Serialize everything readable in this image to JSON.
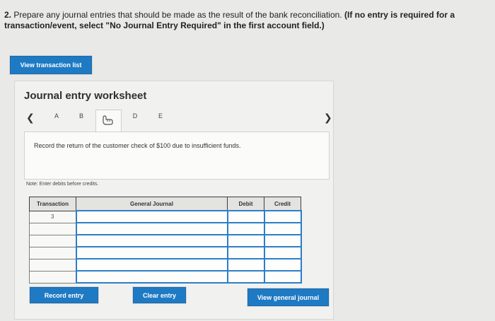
{
  "question": {
    "number": "2.",
    "text": "Prepare any journal entries that should be made as the result of the bank reconciliation.",
    "instruction": "(If no entry is required for a transaction/event, select \"No Journal Entry Required\" in the first account field.)"
  },
  "buttons": {
    "view_transaction_list": "View transaction list",
    "record_entry": "Record entry",
    "clear_entry": "Clear entry",
    "view_general_journal": "View general journal"
  },
  "worksheet": {
    "title": "Journal entry worksheet",
    "tabs": [
      "A",
      "B",
      "C",
      "D",
      "E"
    ],
    "active_tab": "C",
    "instruction": "Record the return of the customer check of $100 due to insufficient funds.",
    "note": "Note: Enter debits before credits."
  },
  "table": {
    "headers": {
      "transaction": "Transaction",
      "general_journal": "General Journal",
      "debit": "Debit",
      "credit": "Credit"
    },
    "rows": [
      {
        "transaction": "3",
        "account": "",
        "debit": "",
        "credit": ""
      },
      {
        "transaction": "",
        "account": "",
        "debit": "",
        "credit": ""
      },
      {
        "transaction": "",
        "account": "",
        "debit": "",
        "credit": ""
      },
      {
        "transaction": "",
        "account": "",
        "debit": "",
        "credit": ""
      },
      {
        "transaction": "",
        "account": "",
        "debit": "",
        "credit": ""
      },
      {
        "transaction": "",
        "account": "",
        "debit": "",
        "credit": ""
      }
    ]
  },
  "icons": {
    "prev": "chevron-left-icon",
    "next": "chevron-right-icon",
    "active_tab": "hand-pointer-icon"
  },
  "colors": {
    "primary_button": "#1f7ac4",
    "input_border": "#2d7ec9"
  }
}
